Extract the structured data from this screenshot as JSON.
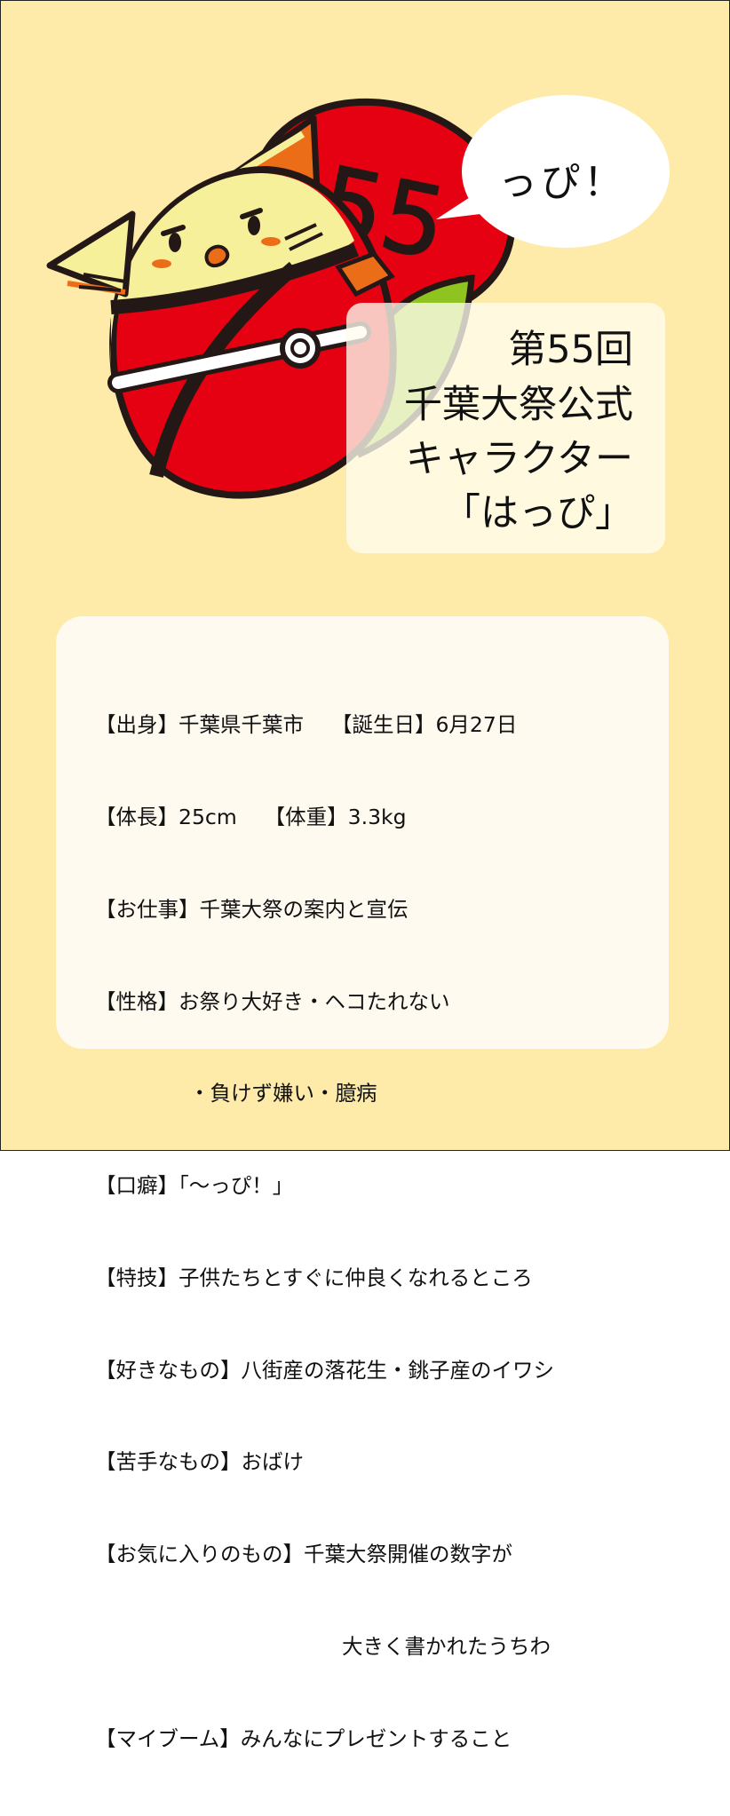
{
  "bubble": {
    "text": "っぴ！"
  },
  "emblem_number": "55",
  "title": {
    "lines": [
      "第55回",
      "千葉大祭公式",
      "キャラクター",
      "「はっぴ」"
    ]
  },
  "profile": {
    "lines": [
      "【出身】千葉県千葉市　 【誕生日】6月27日",
      "【体長】25cm　 【体重】3.3kg",
      "【お仕事】千葉大祭の案内と宣伝",
      "【性格】お祭り大好き・ヘコたれない",
      "・負けず嫌い・臆病",
      "【口癖】「～っぴ！」",
      "【特技】子供たちとすぐに仲良くなれるところ",
      "【好きなもの】八街産の落花生・銚子産のイワシ",
      "【苦手なもの】おばけ",
      "【お気に入りのもの】千葉大祭開催の数字が",
      "大きく書かれたうちわ",
      "【マイブーム】みんなにプレゼントすること"
    ]
  },
  "colors": {
    "background": "#feeaa9",
    "red": "#e50012",
    "yellow": "#f7f09a",
    "orange": "#eb6d17",
    "green": "#8fc31f",
    "outline": "#231815"
  }
}
